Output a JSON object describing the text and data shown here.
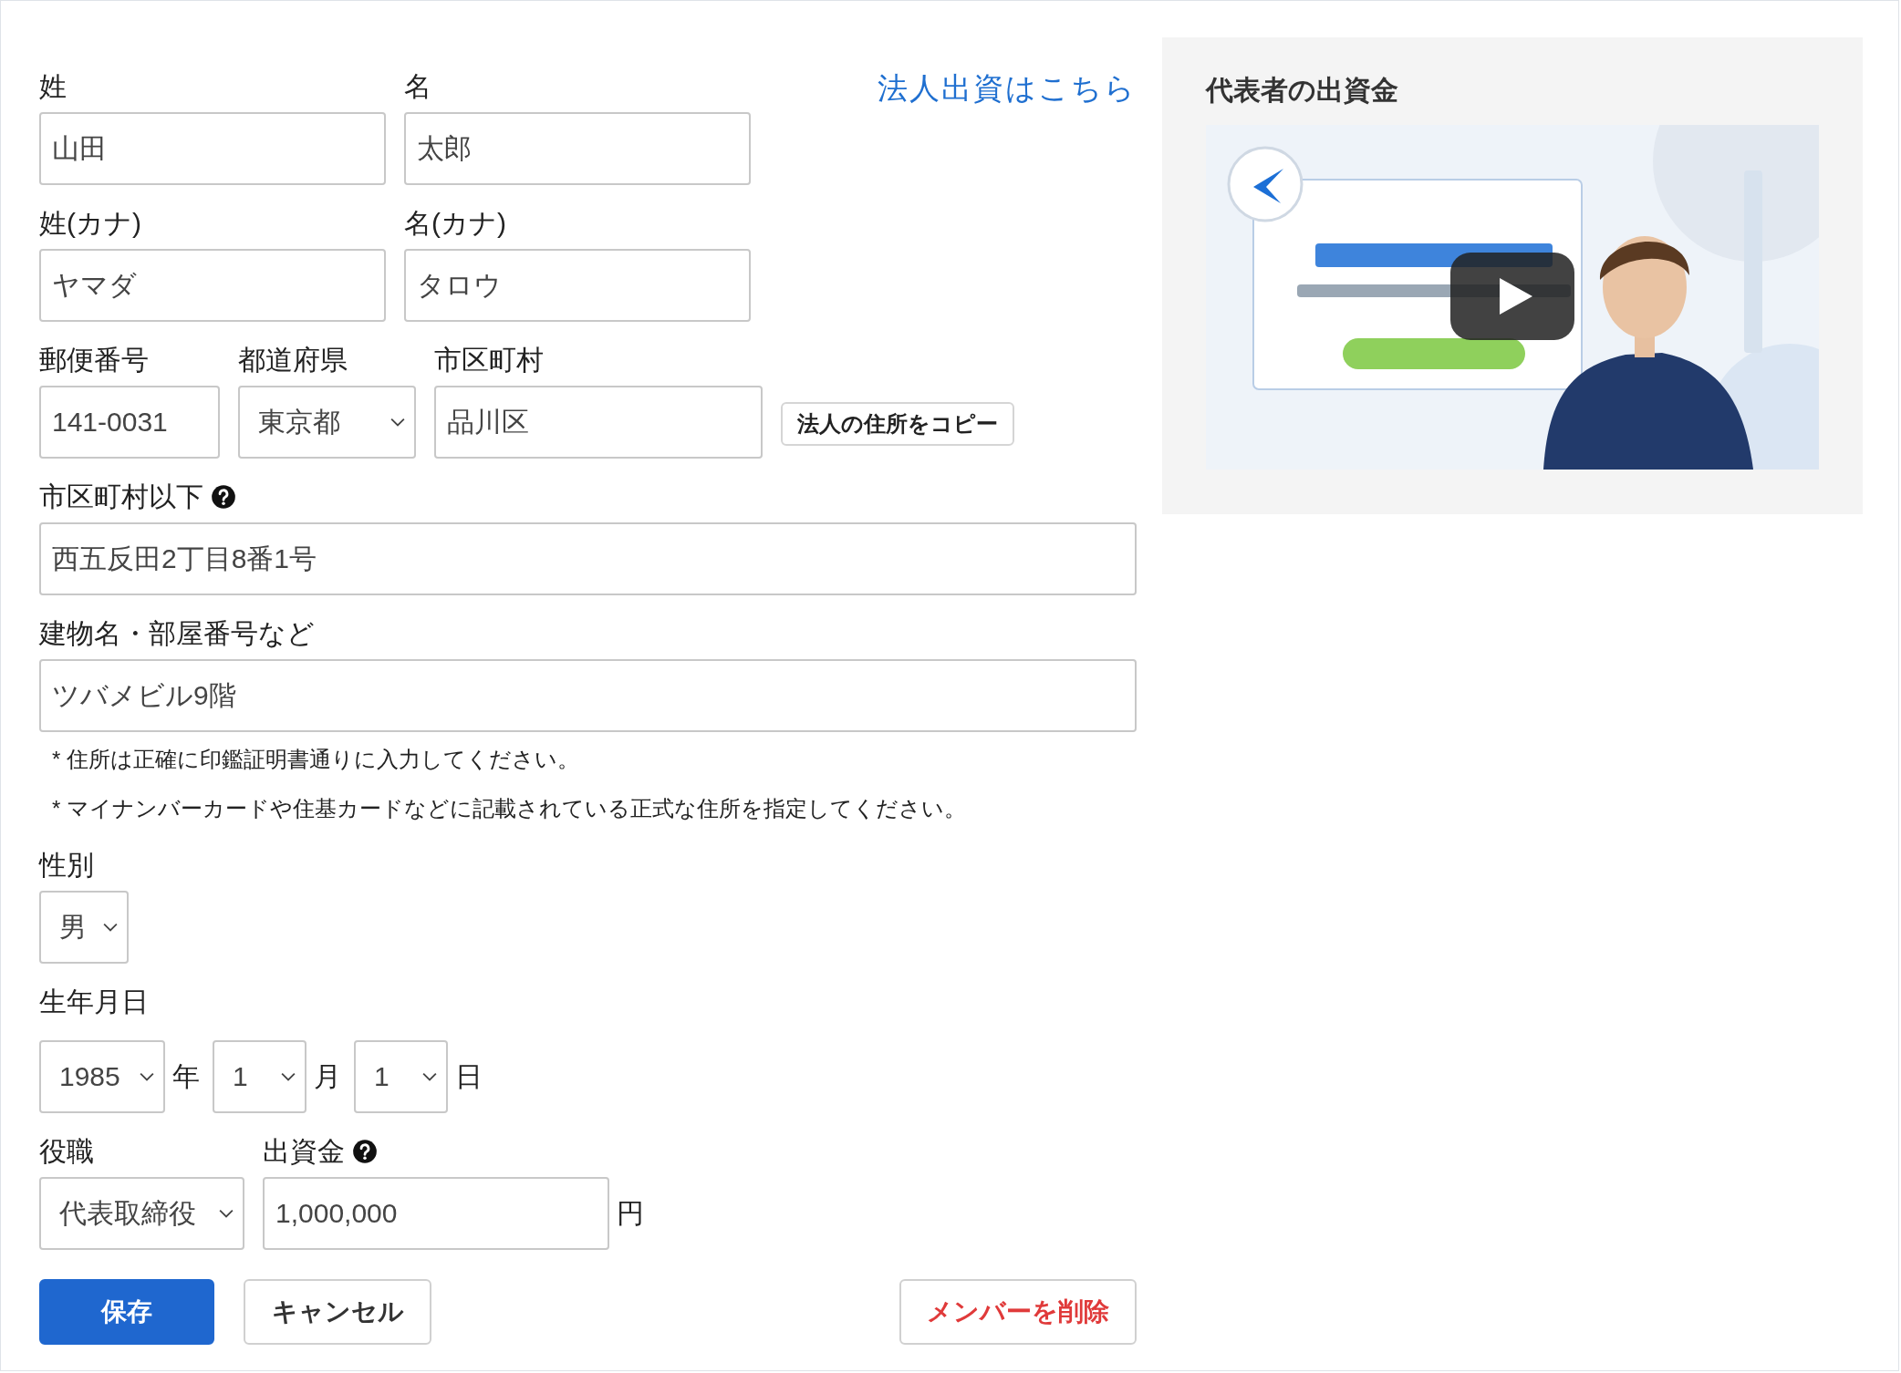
{
  "corporate_link": "法人出資はこちら",
  "name_row": [
    {
      "label": "姓",
      "value": "山田"
    },
    {
      "label": "名",
      "value": "太郎"
    }
  ],
  "kana_row": [
    {
      "label": "姓(カナ)",
      "value": "ヤマダ"
    },
    {
      "label": "名(カナ)",
      "value": "タロウ"
    }
  ],
  "postal": {
    "label": "郵便番号",
    "value": "141-0031"
  },
  "prefecture": {
    "label": "都道府県",
    "value": "東京都"
  },
  "city": {
    "label": "市区町村",
    "value": "品川区"
  },
  "copy_button": "法人の住所をコピー",
  "street": {
    "label": "市区町村以下",
    "help": true,
    "value": "西五反田2丁目8番1号"
  },
  "building": {
    "label": "建物名・部屋番号など",
    "value": "ツバメビル9階"
  },
  "notes": [
    "* 住所は正確に印鑑証明書通りに入力してください。",
    "* マイナンバーカードや住基カードなどに記載されている正式な住所を指定してください。"
  ],
  "gender": {
    "label": "性別",
    "value": "男"
  },
  "birthday": {
    "label": "生年月日",
    "parts": [
      {
        "value": "1985",
        "unit": "年"
      },
      {
        "value": "1",
        "unit": "月"
      },
      {
        "value": "1",
        "unit": "日"
      }
    ]
  },
  "position": {
    "label": "役職",
    "value": "代表取締役"
  },
  "investment": {
    "label": "出資金",
    "help": true,
    "value": "1,000,000",
    "unit": "円"
  },
  "buttons": [
    {
      "kind": "primary",
      "label": "保存"
    },
    {
      "kind": "secondary",
      "label": "キャンセル"
    },
    {
      "kind": "danger",
      "label": "メンバーを削除"
    }
  ],
  "side_panel": {
    "title": "代表者の出資金"
  }
}
